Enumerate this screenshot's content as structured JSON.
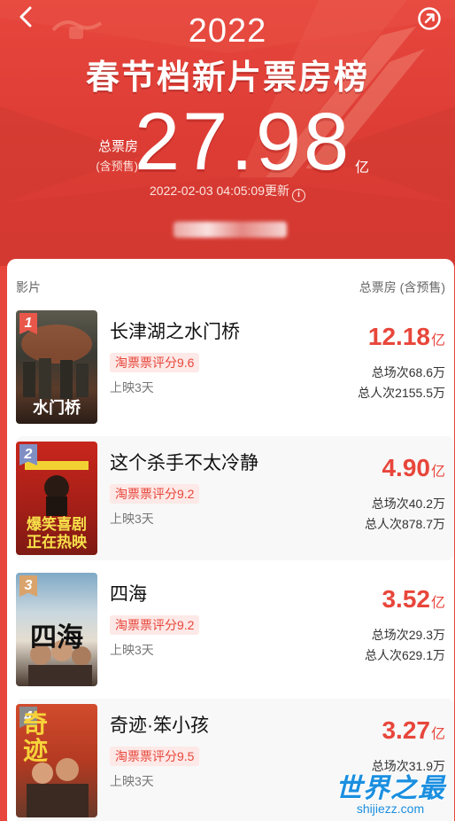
{
  "header": {
    "year": "2022",
    "title": "春节档新片票房榜",
    "total_label": "总票房",
    "total_sublabel": "(含预售)",
    "total_value": "27.98",
    "total_unit": "亿",
    "update_time": "2022-02-03 04:05:09更新",
    "info_icon": "i",
    "back_icon": "‹"
  },
  "table": {
    "col_movie": "影片",
    "col_box": "总票房 (含预售)"
  },
  "movies": [
    {
      "rank": "1",
      "name": "长津湖之水门桥",
      "rating": "淘票票评分9.6",
      "days": "上映3天",
      "box": "12.18",
      "box_unit": "亿",
      "shows": "总场次68.6万",
      "audience": "总人次2155.5万",
      "poster_text": "水门桥",
      "rank_color": "#e8574a"
    },
    {
      "rank": "2",
      "name": "这个杀手不太冷静",
      "rating": "淘票票评分9.2",
      "days": "上映3天",
      "box": "4.90",
      "box_unit": "亿",
      "shows": "总场次40.2万",
      "audience": "总人次878.7万",
      "poster_text": "爆笑喜剧 正在热映",
      "rank_color": "#7f8fc4"
    },
    {
      "rank": "3",
      "name": "四海",
      "rating": "淘票票评分9.2",
      "days": "上映3天",
      "box": "3.52",
      "box_unit": "亿",
      "shows": "总场次29.3万",
      "audience": "总人次629.1万",
      "poster_text": "四海",
      "rank_color": "#d9a36b"
    },
    {
      "rank": "4",
      "name": "奇迹·笨小孩",
      "rating": "淘票票评分9.5",
      "days": "上映3天",
      "box": "3.27",
      "box_unit": "亿",
      "shows": "总场次31.9万",
      "audience": "",
      "poster_text": "奇迹",
      "rank_color": "#8a8a8a"
    }
  ],
  "watermark": {
    "big": "世界之最",
    "small": "shijiezz.com"
  }
}
